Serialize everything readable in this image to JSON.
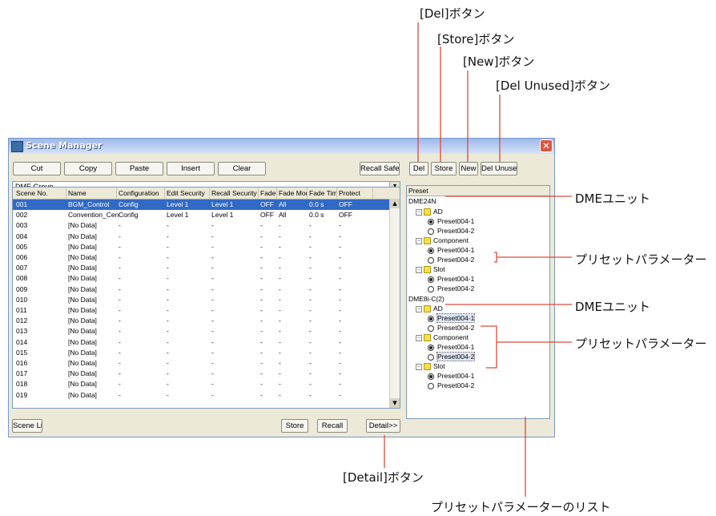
{
  "callouts": {
    "del": "[Del]ボタン",
    "store": "[Store]ボタン",
    "new": "[New]ボタン",
    "del_unused": "[Del Unused]ボタン",
    "dme_unit_1": "DMEユニット",
    "preset_param_1": "プリセットパラメーター",
    "dme_unit_2": "DMEユニット",
    "preset_param_2": "プリセットパラメーター",
    "detail": "[Detail]ボタン",
    "param_list": "プリセットパラメーターのリスト"
  },
  "window": {
    "title": "Scene Manager",
    "close_glyph": "✕"
  },
  "toolbar": {
    "cut": "Cut",
    "copy": "Copy",
    "paste": "Paste",
    "insert": "Insert",
    "clear": "Clear",
    "recall_safe": "Recall Safe",
    "del": "Del",
    "store": "Store",
    "new": "New",
    "del_unused": "Del Unused"
  },
  "group_select": {
    "value": "DME Group"
  },
  "preset_select": {
    "value": "Preset"
  },
  "table": {
    "columns": [
      "Scene No.",
      "Name",
      "Configuration",
      "Edit Security",
      "Recall Security",
      "Fade",
      "Fade Mode",
      "Fade Time",
      "Protect"
    ],
    "rows": [
      [
        "001",
        "BGM_Control",
        "Config",
        "Level 1",
        "Level 1",
        "OFF",
        "All",
        "0.0 s",
        "OFF"
      ],
      [
        "002",
        "Convention_Center",
        "Config",
        "Level 1",
        "Level 1",
        "OFF",
        "All",
        "0.0 s",
        "OFF"
      ],
      [
        "003",
        "[No Data]",
        "-",
        "-",
        "-",
        "-",
        "-",
        "-",
        "-"
      ],
      [
        "004",
        "[No Data]",
        "-",
        "-",
        "-",
        "-",
        "-",
        "-",
        "-"
      ],
      [
        "005",
        "[No Data]",
        "-",
        "-",
        "-",
        "-",
        "-",
        "-",
        "-"
      ],
      [
        "006",
        "[No Data]",
        "-",
        "-",
        "-",
        "-",
        "-",
        "-",
        "-"
      ],
      [
        "007",
        "[No Data]",
        "-",
        "-",
        "-",
        "-",
        "-",
        "-",
        "-"
      ],
      [
        "008",
        "[No Data]",
        "-",
        "-",
        "-",
        "-",
        "-",
        "-",
        "-"
      ],
      [
        "009",
        "[No Data]",
        "-",
        "-",
        "-",
        "-",
        "-",
        "-",
        "-"
      ],
      [
        "010",
        "[No Data]",
        "-",
        "-",
        "-",
        "-",
        "-",
        "-",
        "-"
      ],
      [
        "011",
        "[No Data]",
        "-",
        "-",
        "-",
        "-",
        "-",
        "-",
        "-"
      ],
      [
        "012",
        "[No Data]",
        "-",
        "-",
        "-",
        "-",
        "-",
        "-",
        "-"
      ],
      [
        "013",
        "[No Data]",
        "-",
        "-",
        "-",
        "-",
        "-",
        "-",
        "-"
      ],
      [
        "014",
        "[No Data]",
        "-",
        "-",
        "-",
        "-",
        "-",
        "-",
        "-"
      ],
      [
        "015",
        "[No Data]",
        "-",
        "-",
        "-",
        "-",
        "-",
        "-",
        "-"
      ],
      [
        "016",
        "[No Data]",
        "-",
        "-",
        "-",
        "-",
        "-",
        "-",
        "-"
      ],
      [
        "017",
        "[No Data]",
        "-",
        "-",
        "-",
        "-",
        "-",
        "-",
        "-"
      ],
      [
        "018",
        "[No Data]",
        "-",
        "-",
        "-",
        "-",
        "-",
        "-",
        "-"
      ],
      [
        "019",
        "[No Data]",
        "-",
        "-",
        "-",
        "-",
        "-",
        "-",
        "-"
      ]
    ],
    "selected_index": 0
  },
  "tree": [
    {
      "text": "DME24N",
      "level": 0,
      "kind": "unit"
    },
    {
      "text": "AD",
      "level": 1,
      "kind": "folder"
    },
    {
      "text": "Preset004-1",
      "level": 2,
      "kind": "preset",
      "on": true
    },
    {
      "text": "Preset004-2",
      "level": 2,
      "kind": "preset",
      "on": false
    },
    {
      "text": "Component",
      "level": 1,
      "kind": "folder"
    },
    {
      "text": "Preset004-1",
      "level": 2,
      "kind": "preset",
      "on": true
    },
    {
      "text": "Preset004-2",
      "level": 2,
      "kind": "preset",
      "on": false
    },
    {
      "text": "Slot",
      "level": 1,
      "kind": "folder"
    },
    {
      "text": "Preset004-1",
      "level": 2,
      "kind": "preset",
      "on": true
    },
    {
      "text": "Preset004-2",
      "level": 2,
      "kind": "preset",
      "on": false
    },
    {
      "text": "DME8i-C(2)",
      "level": 0,
      "kind": "unit"
    },
    {
      "text": "AD",
      "level": 1,
      "kind": "folder"
    },
    {
      "text": "Preset004-1",
      "level": 2,
      "kind": "preset",
      "on": true,
      "highlight": true
    },
    {
      "text": "Preset004-2",
      "level": 2,
      "kind": "preset",
      "on": false
    },
    {
      "text": "Component",
      "level": 1,
      "kind": "folder"
    },
    {
      "text": "Preset004-1",
      "level": 2,
      "kind": "preset",
      "on": true
    },
    {
      "text": "Preset004-2",
      "level": 2,
      "kind": "preset",
      "on": false,
      "highlight": true
    },
    {
      "text": "Slot",
      "level": 1,
      "kind": "folder"
    },
    {
      "text": "Preset004-1",
      "level": 2,
      "kind": "preset",
      "on": true
    },
    {
      "text": "Preset004-2",
      "level": 2,
      "kind": "preset",
      "on": false
    }
  ],
  "bottom": {
    "scene_link": "Scene Link",
    "store": "Store",
    "recall": "Recall",
    "detail": "Detail>>"
  },
  "colors": {
    "callout_line": "#d94a3a",
    "selection": "#316ac5"
  }
}
